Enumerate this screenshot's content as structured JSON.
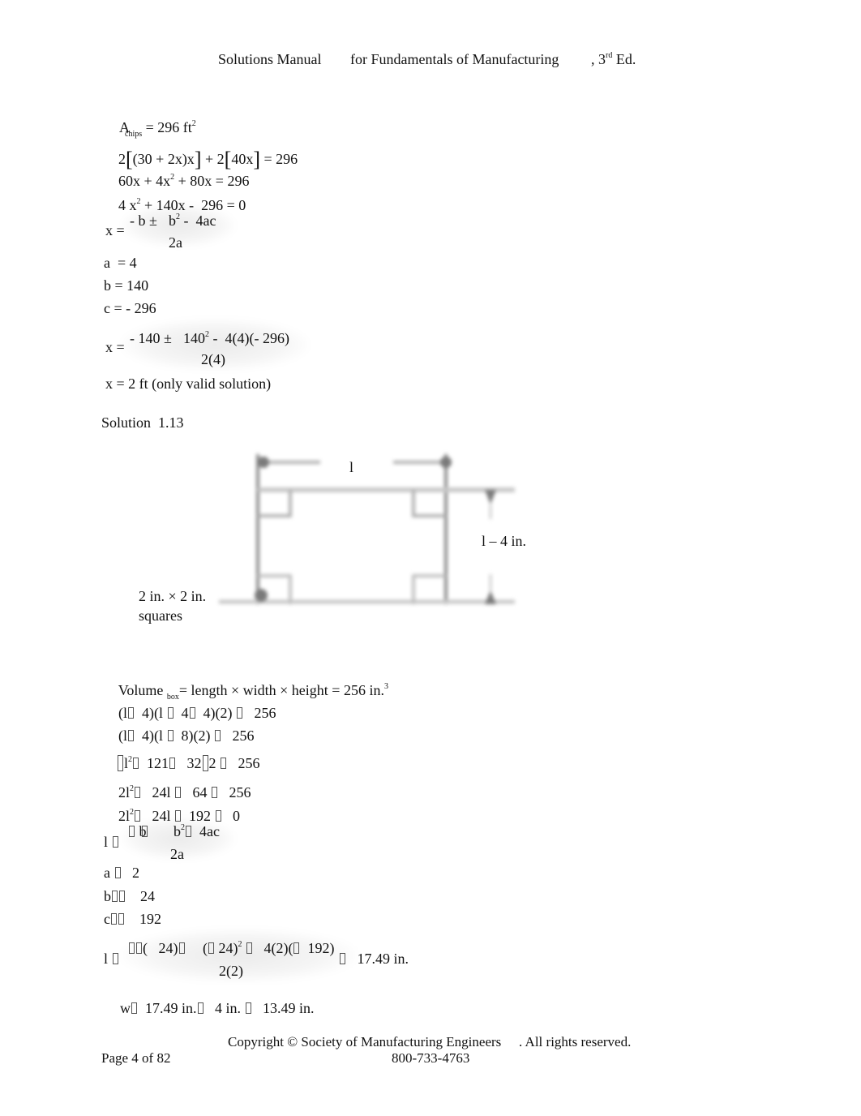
{
  "header": {
    "title_part1": "Solutions Manual",
    "title_part2": "for Fundamentals of Manufacturing",
    "title_part3": ", 3",
    "edition_sup": "rd",
    "title_part4": " Ed."
  },
  "part1": {
    "area_label": "A",
    "area_sub": "chips",
    "area_rhs": " = 296 ft",
    "area_sup": "2",
    "eq2_a": "2",
    "eq2_b": "(30 + 2x)x",
    "eq2_c": " + 2",
    "eq2_d": "40x",
    "eq2_e": " = 296",
    "eq3_a": "60x + 4x",
    "eq3_sup": "2",
    "eq3_b": " + 80x = 296",
    "eq4_a": "4 x",
    "eq4_sup": "2",
    "eq4_b": " + 140x -  296 = 0",
    "quad_lhs": "x =",
    "quad_num_a": "- b ±",
    "quad_num_b": "b",
    "quad_num_sup": "2",
    "quad_num_c": " -  4ac",
    "quad_den": "2a",
    "coef_a": "a  = 4",
    "coef_b": "b = 140",
    "coef_c": "c = - 296",
    "sub_lhs": "x =",
    "sub_num_a": "- 140 ±",
    "sub_num_b": "140",
    "sub_num_sup": "2",
    "sub_num_c": " -  4(4)(- 296)",
    "sub_den": "2(4)",
    "result": "x = 2 ft (only valid solution)"
  },
  "solution_heading": "Solution  1.13",
  "diagram": {
    "top_label": "l",
    "side_label": "l – 4 in.",
    "corner_label_line1": "2 in. × 2 in.",
    "corner_label_line2": "squares"
  },
  "part2": {
    "vol_a": "Volume ",
    "vol_sub": "box",
    "vol_b": "= length × width × height = 256 in.",
    "vol_sup": "3",
    "l1_a": "(l",
    "l1_b": "  4)(l ",
    "l1_c": "  4",
    "l1_d": "  4)(2) ",
    "l1_e": "   256",
    "l2_a": "(l",
    "l2_b": "  4)(l ",
    "l2_c": "  8)(2) ",
    "l2_d": "   256",
    "l3_a": "l",
    "l3_sup": "2",
    "l3_b": "  121",
    "l3_c": "   32",
    "l3_d": "2 ",
    "l3_e": "   256",
    "l4_a": "2l",
    "l4_sup": "2",
    "l4_b": "   24l ",
    "l4_c": "   64 ",
    "l4_d": "   256",
    "l5_a": "2l",
    "l5_sup": "2",
    "l5_b": "   24l ",
    "l5_c": "  192 ",
    "l5_d": "   0",
    "q_lhs": "l ",
    "q_num_a": "b",
    "q_num_b": "b",
    "q_num_sup": "2",
    "q_num_c": "  4ac",
    "q_den": "2a",
    "ca": "a ",
    "ca_val": "   2",
    "cb": "b",
    "cb_val": "    24",
    "cc": "c",
    "cc_val": "    192",
    "s_lhs": "l ",
    "s_num_a": "(   24)",
    "s_num_b": "(",
    "s_num_c": " 24)",
    "s_num_sup": "2",
    "s_num_d": "   4(2)(",
    "s_num_e": "  192)",
    "s_den": "2(2)",
    "s_result": "   17.49 in.",
    "w_a": "w",
    "w_b": "  17.49 in.",
    "w_c": "   4 in. ",
    "w_d": "   13.49 in."
  },
  "footer": {
    "copyright_a": "Copyright © Society of Manufacturing Engineers",
    "copyright_b": ". All rights reserved.",
    "page": "Page 4 of 82",
    "phone": "800-733-4763"
  }
}
